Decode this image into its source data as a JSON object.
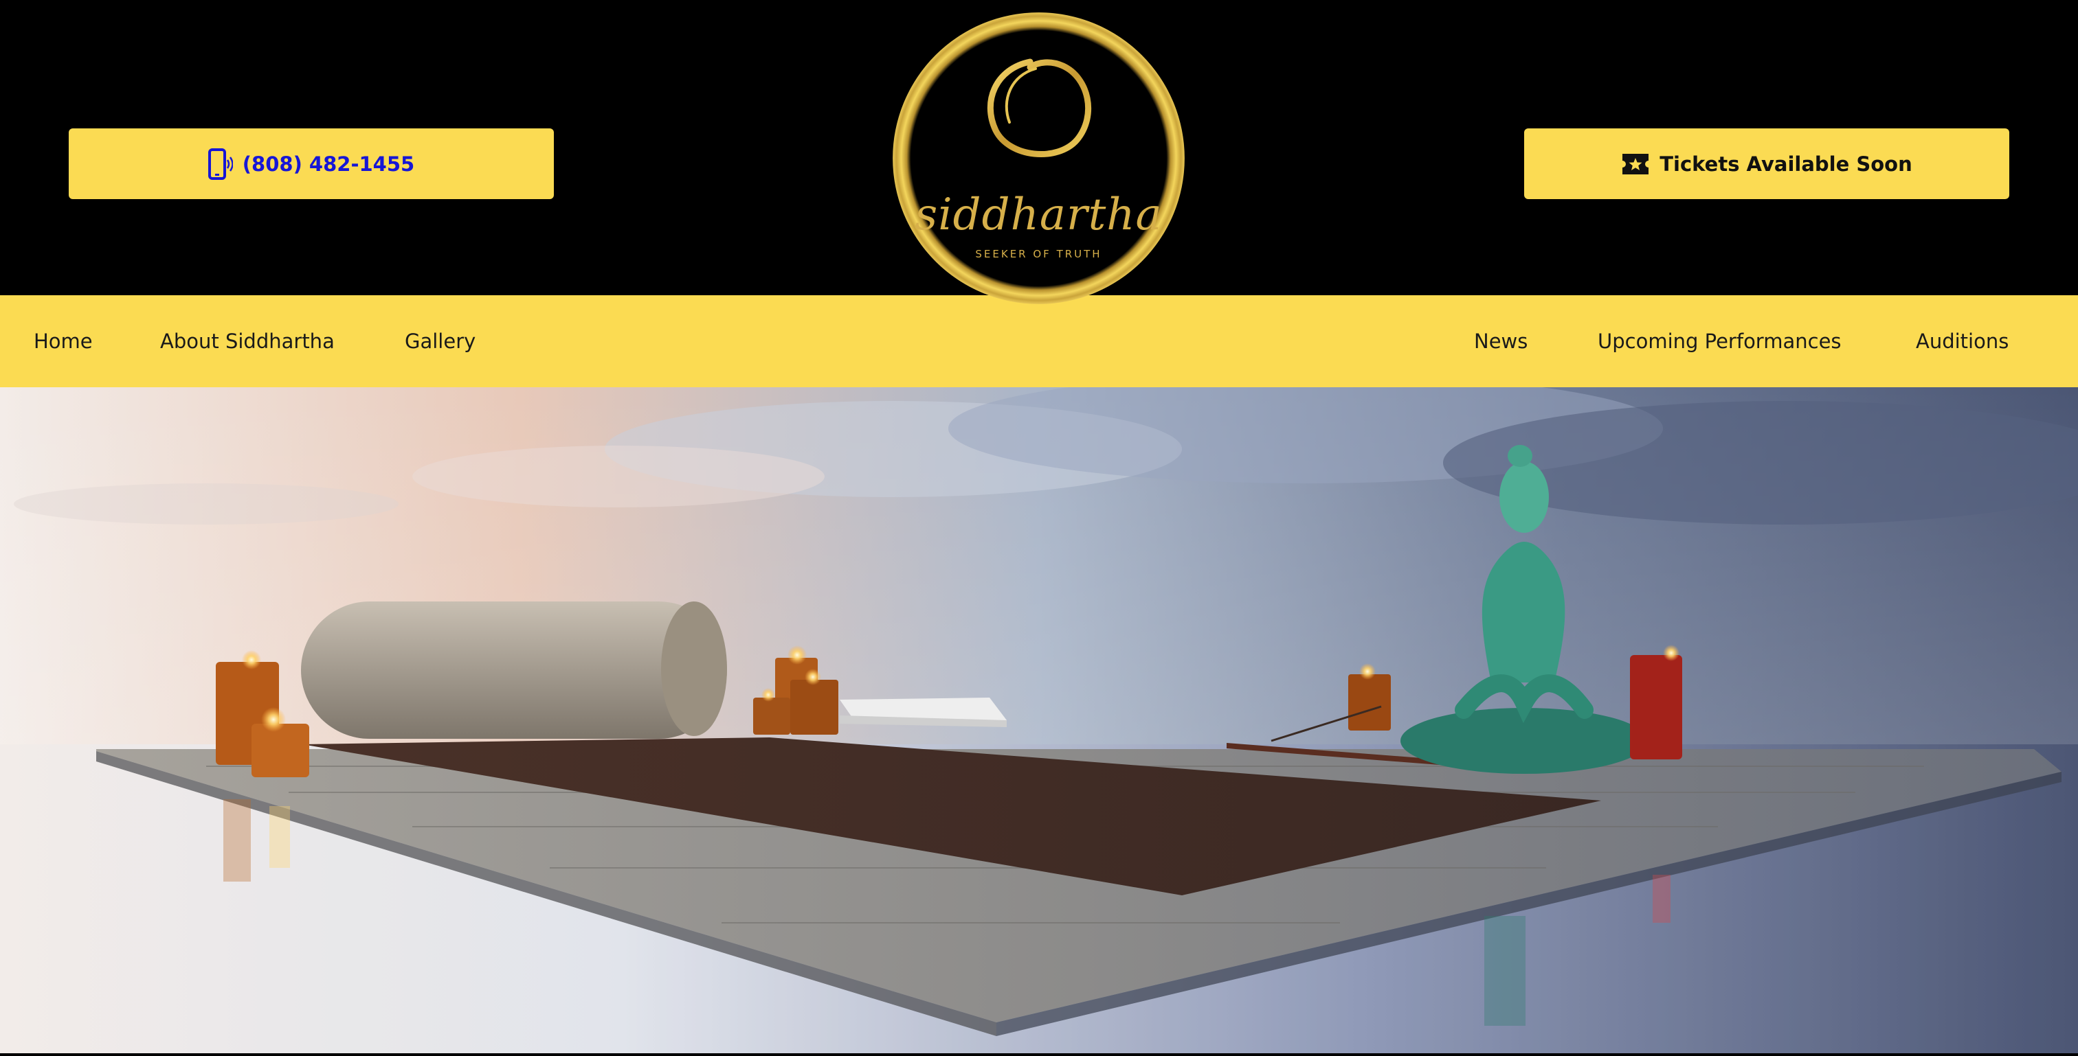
{
  "header": {
    "phone_label": "(808) 482-1455",
    "tickets_label": "Tickets Available Soon",
    "phone_icon": "mobile-phone-icon",
    "tickets_icon": "ticket-icon"
  },
  "logo": {
    "title": "siddhartha",
    "tagline": "SEEKER OF TRUTH"
  },
  "nav": {
    "items": [
      {
        "label": "Home"
      },
      {
        "label": "About Siddhartha"
      },
      {
        "label": "Gallery"
      },
      {
        "label": "News"
      },
      {
        "label": "Upcoming Performances"
      },
      {
        "label": "Auditions"
      }
    ]
  },
  "colors": {
    "accent": "#fbdb53",
    "phone_text": "#1616d6",
    "logo_gold": "#d7b04a",
    "header_bg": "#000000"
  }
}
